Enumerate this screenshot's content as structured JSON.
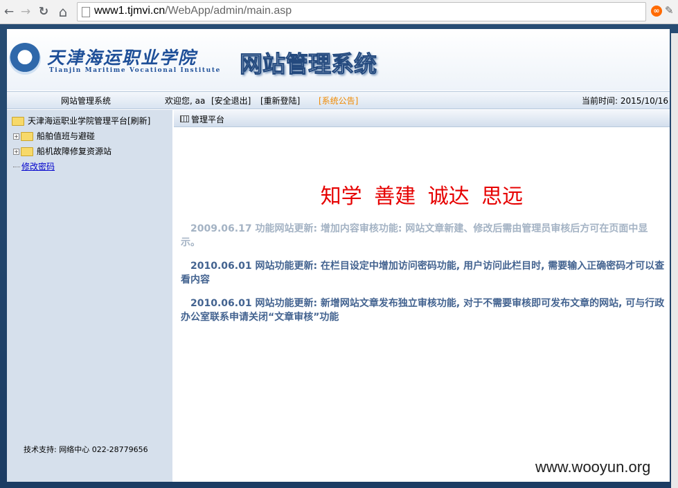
{
  "browser": {
    "back_glyph": "←",
    "forward_glyph": "→",
    "reload_glyph": "↻",
    "home_glyph": "⌂",
    "url_host": "www1.tjmvi.cn",
    "url_path": "/WebApp/admin/main.asp"
  },
  "header": {
    "school_name_cn": "天津海运职业学院",
    "school_name_en": "Tianjin Maritime Vocational Institute",
    "system_title": "网站管理系统"
  },
  "topbar": {
    "system_name": "网站管理系统",
    "welcome": "欢迎您, aa",
    "logout_label": "[安全退出]",
    "relogin_label": "[重新登陆]",
    "notice_label": "[系统公告]",
    "time_label": "当前时间: 2015/10/16"
  },
  "sidebar": {
    "root_label": "天津海运职业学院管理平台[刷新]",
    "items": [
      {
        "label": "船舶值班与避碰"
      },
      {
        "label": "船机故障修复资源站"
      }
    ],
    "change_password": "修改密码",
    "support": "技术支持: 网络中心  022-28779656"
  },
  "main": {
    "tab_label": "管理平台",
    "motto": "知学 善建 诚达 思远",
    "news": [
      {
        "text": "2009.06.17 功能网站更新: 增加内容审核功能: 网站文章新建、修改后需由管理员审核后方可在页面中显示。"
      },
      {
        "text": "2010.06.01 网站功能更新: 在栏目设定中增加访问密码功能, 用户访问此栏目时, 需要输入正确密码才可以查看内容"
      },
      {
        "text": "2010.06.01 网站功能更新: 新增网站文章发布独立审核功能, 对于不需要审核即可发布文章的网站, 可与行政办公室联系申请关闭“文章审核”功能"
      }
    ]
  },
  "watermark": "www.wooyun.org",
  "colors": {
    "frame": "#1f4670",
    "sidebar": "#d6e0ec",
    "motto": "#e60000",
    "news": "#436390",
    "notice": "#f08a00"
  }
}
